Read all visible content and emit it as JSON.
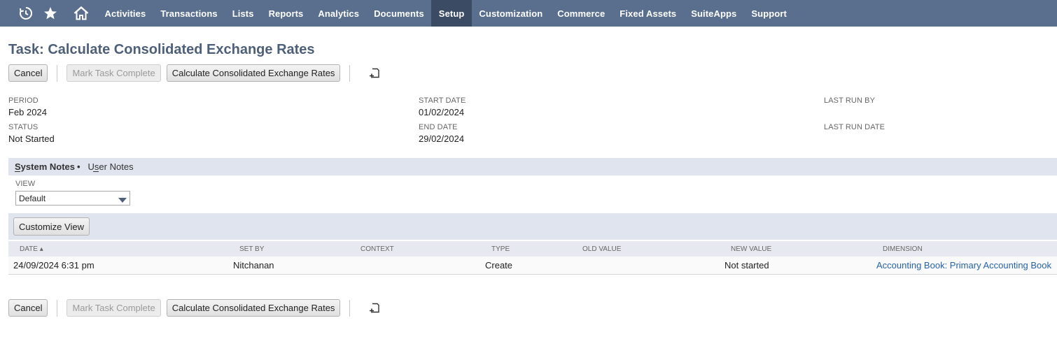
{
  "nav": {
    "items": [
      {
        "label": "Activities",
        "active": false
      },
      {
        "label": "Transactions",
        "active": false
      },
      {
        "label": "Lists",
        "active": false
      },
      {
        "label": "Reports",
        "active": false
      },
      {
        "label": "Analytics",
        "active": false
      },
      {
        "label": "Documents",
        "active": false
      },
      {
        "label": "Setup",
        "active": true
      },
      {
        "label": "Customization",
        "active": false
      },
      {
        "label": "Commerce",
        "active": false
      },
      {
        "label": "Fixed Assets",
        "active": false
      },
      {
        "label": "SuiteApps",
        "active": false
      },
      {
        "label": "Support",
        "active": false
      }
    ],
    "icons": [
      "recent-records-icon",
      "favorites-star-icon",
      "home-icon"
    ]
  },
  "page": {
    "title": "Task: Calculate Consolidated Exchange Rates"
  },
  "actions": {
    "cancel_label": "Cancel",
    "mark_complete_label": "Mark Task Complete",
    "calculate_label": "Calculate Consolidated Exchange Rates"
  },
  "fields": {
    "period_label": "PERIOD",
    "period_value": "Feb 2024",
    "status_label": "STATUS",
    "status_value": "Not Started",
    "start_date_label": "START DATE",
    "start_date_value": "01/02/2024",
    "end_date_label": "END DATE",
    "end_date_value": "29/02/2024",
    "last_run_by_label": "LAST RUN BY",
    "last_run_date_label": "LAST RUN DATE"
  },
  "subtabs": {
    "system_notes": "System Notes",
    "system_notes_dot": "•",
    "user_notes": "User Notes"
  },
  "view": {
    "label": "VIEW",
    "selected": "Default",
    "customize_label": "Customize View"
  },
  "table": {
    "headers": {
      "date": "DATE ▴",
      "set_by": "SET BY",
      "context": "CONTEXT",
      "type": "TYPE",
      "old_value": "OLD VALUE",
      "new_value": "NEW VALUE",
      "dimension": "DIMENSION"
    },
    "rows": [
      {
        "date": "24/09/2024 6:31 pm",
        "set_by": "Nitchanan",
        "context": "",
        "type": "Create",
        "old_value": "",
        "new_value": "Not started",
        "dimension": "Accounting Book: Primary Accounting Book"
      }
    ]
  },
  "colors": {
    "nav_bg": "#5a6f8e",
    "nav_active": "#3b4b63",
    "title": "#4d5f79",
    "link": "#2763a9",
    "subtab_bg": "#dfe4ee"
  }
}
